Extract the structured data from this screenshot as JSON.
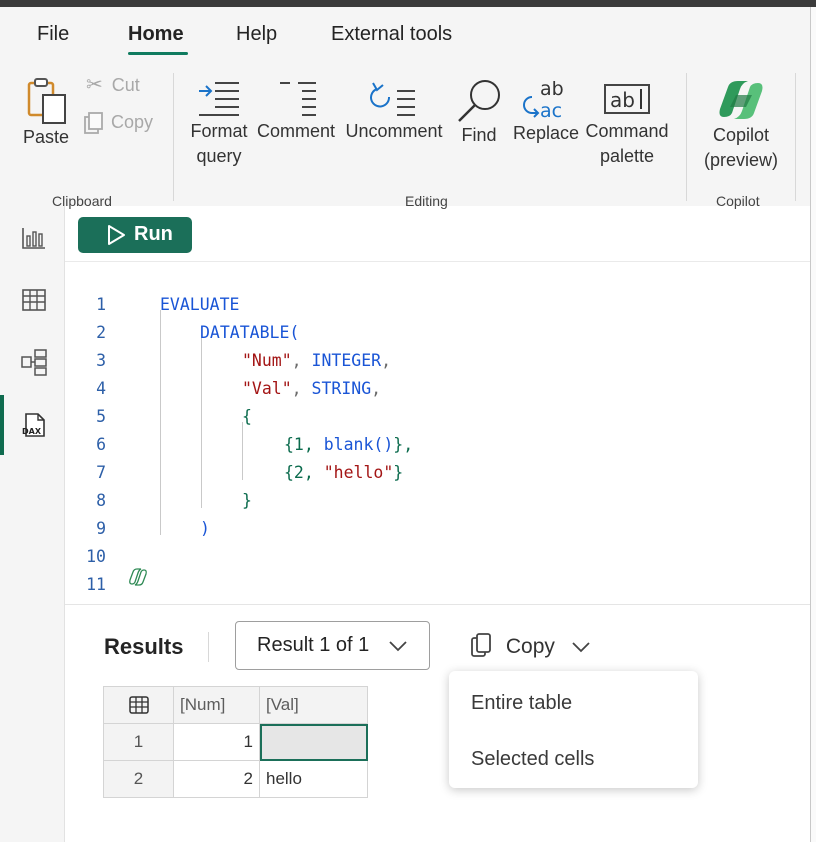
{
  "menu_tabs": [
    "File",
    "Home",
    "Help",
    "External tools"
  ],
  "ribbon": {
    "paste": "Paste",
    "cut": "Cut",
    "copy": "Copy",
    "format_query": "Format\nquery",
    "comment": "Comment",
    "uncomment": "Uncomment",
    "find": "Find",
    "replace": "Replace",
    "command_palette": "Command\npalette",
    "copilot": "Copilot\n(preview)",
    "groups": [
      "Clipboard",
      "Editing",
      "Copilot"
    ]
  },
  "run_label": "Run",
  "editor": {
    "line_numbers": [
      "1",
      "2",
      "3",
      "4",
      "5",
      "6",
      "7",
      "8",
      "9",
      "10",
      "11"
    ],
    "lines": [
      [
        {
          "t": "EVALUATE",
          "c": "kw"
        }
      ],
      [
        {
          "t": "DATATABLE(",
          "c": "kw"
        }
      ],
      [
        {
          "t": "\"Num\"",
          "c": "str"
        },
        {
          "t": ", ",
          "c": "pun"
        },
        {
          "t": "INTEGER",
          "c": "kw"
        },
        {
          "t": ",",
          "c": "pun"
        }
      ],
      [
        {
          "t": "\"Val\"",
          "c": "str"
        },
        {
          "t": ", ",
          "c": "pun"
        },
        {
          "t": "STRING",
          "c": "kw"
        },
        {
          "t": ",",
          "c": "pun"
        }
      ],
      [
        {
          "t": "{",
          "c": "num"
        }
      ],
      [
        {
          "t": "{1, ",
          "c": "num"
        },
        {
          "t": "blank()",
          "c": "kw"
        },
        {
          "t": "},",
          "c": "num"
        }
      ],
      [
        {
          "t": "{2, ",
          "c": "num"
        },
        {
          "t": "\"hello\"",
          "c": "str"
        },
        {
          "t": "}",
          "c": "num"
        }
      ],
      [
        {
          "t": "}",
          "c": "num"
        }
      ],
      [
        {
          "t": ")",
          "c": "kw"
        }
      ],
      [],
      []
    ]
  },
  "results": {
    "title": "Results",
    "selector": "Result 1 of 1",
    "copy_label": "Copy",
    "copy_menu": [
      "Entire table",
      "Selected cells"
    ],
    "columns": [
      "[Num]",
      "[Val]"
    ],
    "rows": [
      {
        "index": "1",
        "num": "1",
        "val": ""
      },
      {
        "index": "2",
        "num": "2",
        "val": "hello"
      }
    ]
  },
  "colors": {
    "accent": "#1b6f59",
    "keyword": "#1a55d6",
    "string": "#a31515",
    "brace": "#0b6b4d"
  }
}
